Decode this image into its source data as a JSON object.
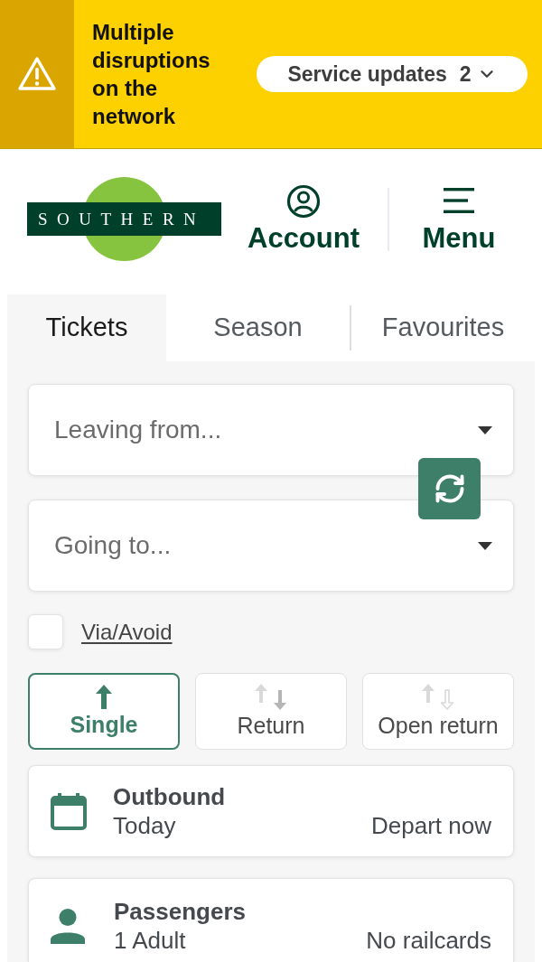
{
  "alert": {
    "message": "Multiple disruptions on the network",
    "updates_button": {
      "label": "Service updates",
      "count": "2"
    }
  },
  "header": {
    "logo": {
      "wordmark": "SOUTHERN"
    },
    "nav": [
      {
        "kind": "account",
        "label": "Account"
      },
      {
        "kind": "menu",
        "label": "Menu"
      }
    ]
  },
  "tabs": [
    {
      "label": "Tickets",
      "selected": true
    },
    {
      "label": "Season",
      "selected": false
    },
    {
      "label": "Favourites",
      "selected": false
    }
  ],
  "journey": {
    "from": {
      "placeholder": "Leaving from..."
    },
    "to": {
      "placeholder": "Going to..."
    }
  },
  "via_avoid": {
    "label": "Via/Avoid",
    "checked": false
  },
  "ticket_types": [
    {
      "kind": "single",
      "label": "Single",
      "selected": true
    },
    {
      "kind": "return",
      "label": "Return",
      "selected": false
    },
    {
      "kind": "open_return",
      "label": "Open return",
      "selected": false
    }
  ],
  "outbound": {
    "title": "Outbound",
    "date": "Today",
    "time": "Depart now"
  },
  "passengers": {
    "title": "Passengers",
    "summary": "1 Adult",
    "railcards": "No railcards"
  }
}
